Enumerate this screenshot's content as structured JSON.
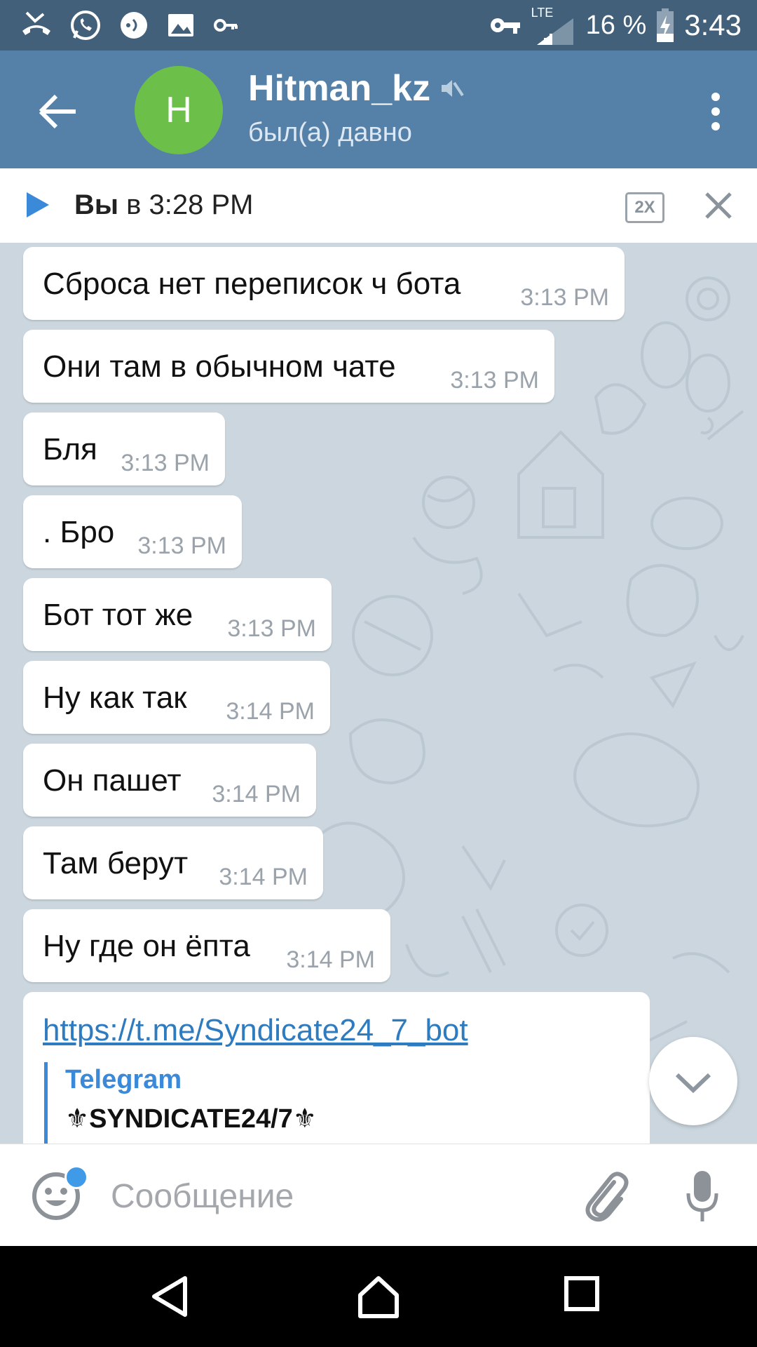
{
  "status_bar": {
    "lte_label": "LTE",
    "battery_percent": "16 %",
    "time": "3:43"
  },
  "header": {
    "back_icon": "arrow-left-icon",
    "avatar_letter": "H",
    "avatar_color": "#6cc04a",
    "title": "Hitman_kz",
    "muted_icon": "muted-speaker-icon",
    "subtitle": "был(а) давно",
    "menu_icon": "more-vertical-icon"
  },
  "audio_player": {
    "sender": "Вы",
    "time_text": "в 3:28 PM",
    "speed_label": "2X"
  },
  "messages": [
    {
      "text": "Сброса нет переписок ч бота",
      "time": "3:13 PM"
    },
    {
      "text": "Они там в обычном чате",
      "time": "3:13 PM"
    },
    {
      "text": "Бля",
      "time": "3:13 PM"
    },
    {
      "text": ". Бро",
      "time": "3:13 PM"
    },
    {
      "text": "Бот тот же",
      "time": "3:13 PM"
    },
    {
      "text": "Ну как так",
      "time": "3:14 PM"
    },
    {
      "text": "Он пашет",
      "time": "3:14 PM"
    },
    {
      "text": "Там берут",
      "time": "3:14 PM"
    },
    {
      "text": "Ну где он ёпта",
      "time": "3:14 PM"
    }
  ],
  "link_message": {
    "url": "https://t.me/Syndicate24_7_bot",
    "preview_site": "Telegram",
    "preview_title": "⚜SYNDICATE24/7⚜"
  },
  "input_bar": {
    "placeholder": "Сообщение"
  },
  "colors": {
    "status_bar": "#42607a",
    "app_bar": "#5581a8",
    "link": "#2f7bc0",
    "accent": "#3b8ad9"
  }
}
